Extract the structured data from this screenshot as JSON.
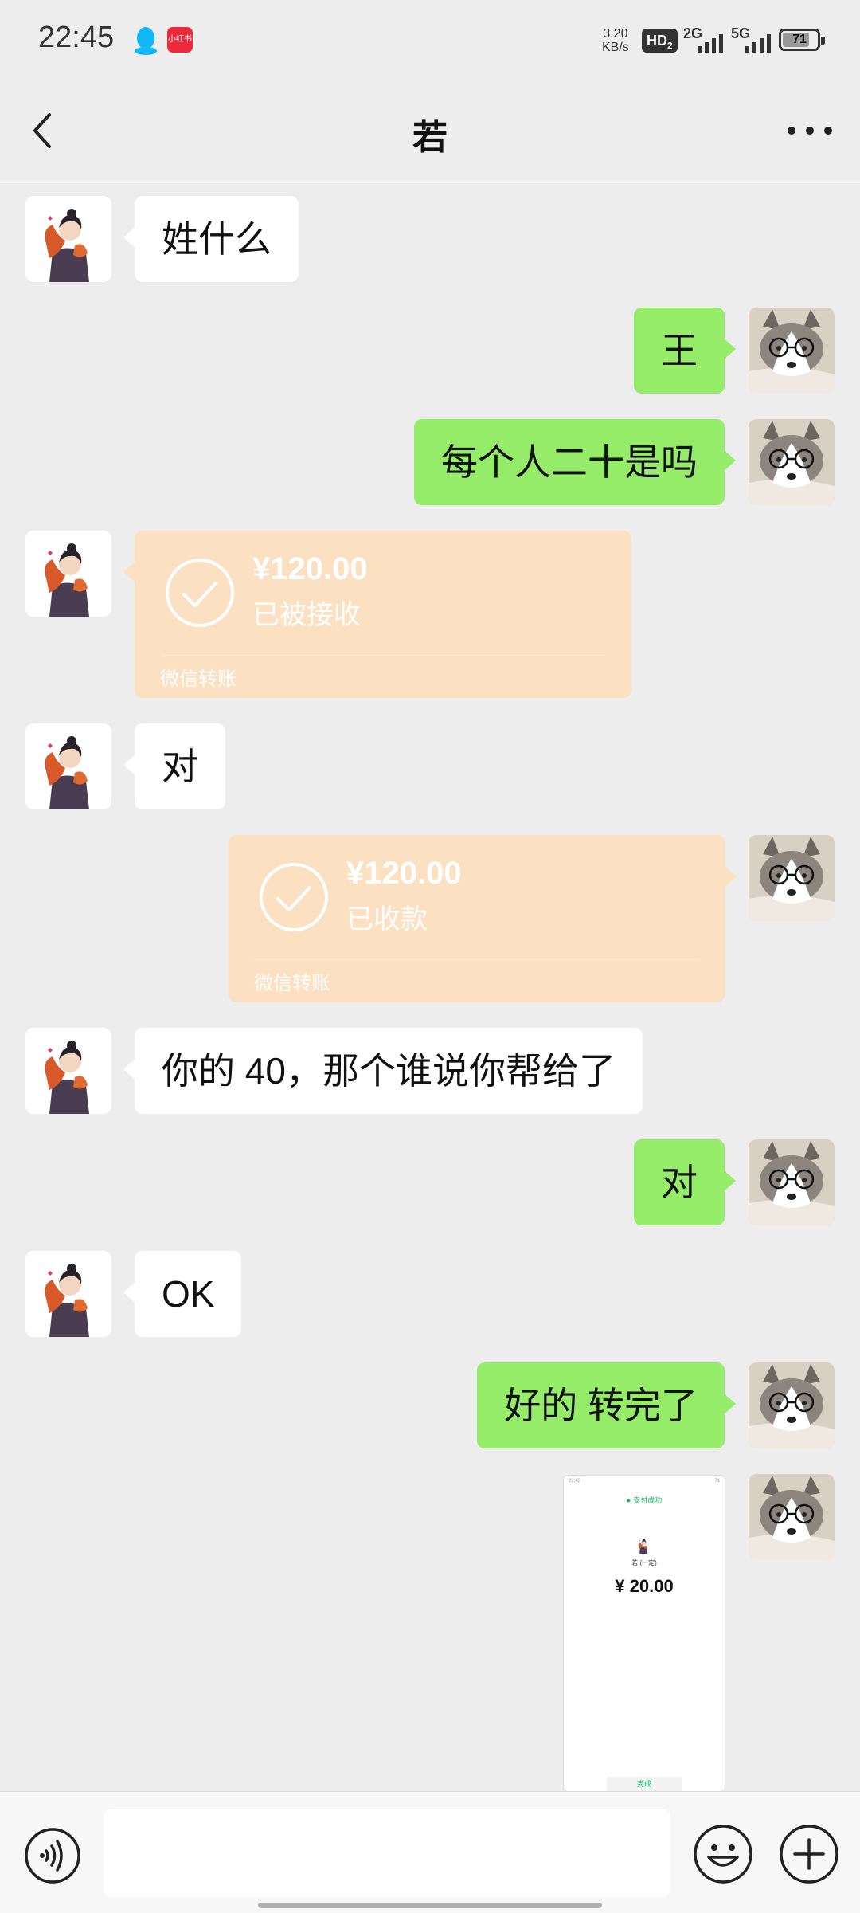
{
  "status_bar": {
    "time": "22:45",
    "net_speed": "3.20",
    "net_speed_unit": "KB/s",
    "hd": "HD",
    "hd_sub": "2",
    "sim1": "2G",
    "sim2": "5G",
    "battery": "71"
  },
  "header": {
    "title": "若"
  },
  "messages": [
    {
      "side": "in",
      "type": "text",
      "text": "姓什么"
    },
    {
      "side": "out",
      "type": "text",
      "text": "王"
    },
    {
      "side": "out",
      "type": "text",
      "text": "每个人二十是吗"
    },
    {
      "side": "in",
      "type": "transfer",
      "amount": "¥120.00",
      "status": "已被接收",
      "footer": "微信转账"
    },
    {
      "side": "in",
      "type": "text",
      "text": "对"
    },
    {
      "side": "out",
      "type": "transfer",
      "amount": "¥120.00",
      "status": "已收款",
      "footer": "微信转账"
    },
    {
      "side": "in",
      "type": "text",
      "text": "你的 40，那个谁说你帮给了"
    },
    {
      "side": "out",
      "type": "text",
      "text": "对"
    },
    {
      "side": "in",
      "type": "text",
      "text": "OK"
    },
    {
      "side": "out",
      "type": "text",
      "text": "好的 转完了"
    },
    {
      "side": "out",
      "type": "image",
      "preview": {
        "header": "支付成功",
        "name": "若 (一定)",
        "amount": "¥ 20.00",
        "button": "完成"
      }
    }
  ],
  "input": {
    "placeholder": ""
  },
  "colors": {
    "background": "#ededed",
    "outgoing_bubble": "#95ec69",
    "incoming_bubble": "#ffffff",
    "transfer_card": "#fbe0c2"
  }
}
